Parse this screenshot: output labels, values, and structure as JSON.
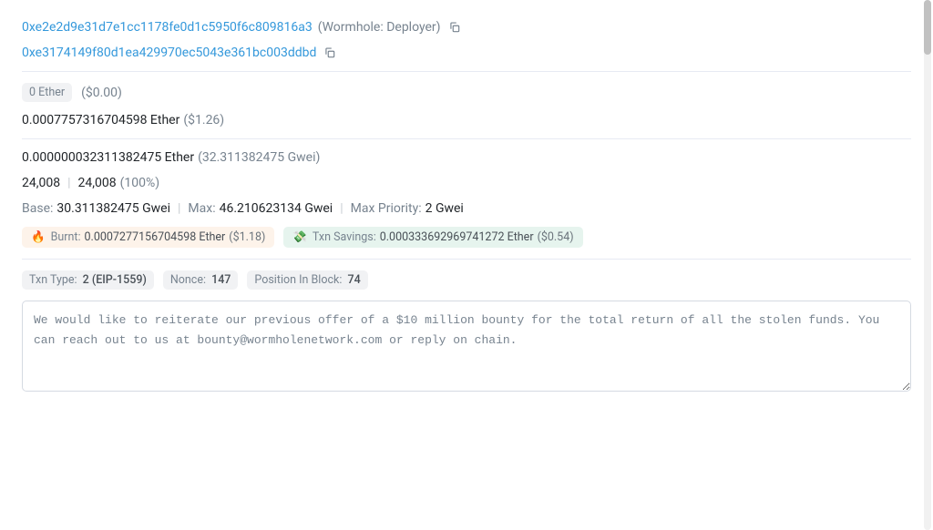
{
  "addresses": {
    "from": "0xe2e2d9e31d7e1cc1178fe0d1c5950f6c809816a3",
    "from_label": "(Wormhole: Deployer)",
    "to": "0xe3174149f80d1ea429970ec5043e361bc003ddbd"
  },
  "value": {
    "amount": "0 Ether",
    "usd": "($0.00)"
  },
  "txn_fee": {
    "eth": "0.0007757316704598 Ether",
    "usd": "($1.26)"
  },
  "gas_price": {
    "eth": "0.000000032311382475 Ether",
    "gwei": "(32.311382475 Gwei)"
  },
  "gas_usage": {
    "limit": "24,008",
    "used": "24,008",
    "pct": "(100%)"
  },
  "fees": {
    "base_label": "Base:",
    "base_value": "30.311382475 Gwei",
    "max_label": "Max:",
    "max_value": "46.210623134 Gwei",
    "max_priority_label": "Max Priority:",
    "max_priority_value": "2 Gwei"
  },
  "burnt": {
    "label": "Burnt:",
    "eth": "0.0007277156704598 Ether",
    "usd": "($1.18)"
  },
  "savings": {
    "label": "Txn Savings:",
    "eth": "0.000333692969741272 Ether",
    "usd": "($0.54)"
  },
  "meta": {
    "type_label": "Txn Type:",
    "type_value": "2 (EIP-1559)",
    "nonce_label": "Nonce:",
    "nonce_value": "147",
    "position_label": "Position In Block:",
    "position_value": "74"
  },
  "input_data": "We would like to reiterate our previous offer of a $10 million bounty for the total return of all the stolen funds. You can reach out to us at bounty@wormholenetwork.com or reply on chain.",
  "icons": {
    "fire": "🔥",
    "savings": "💸"
  }
}
